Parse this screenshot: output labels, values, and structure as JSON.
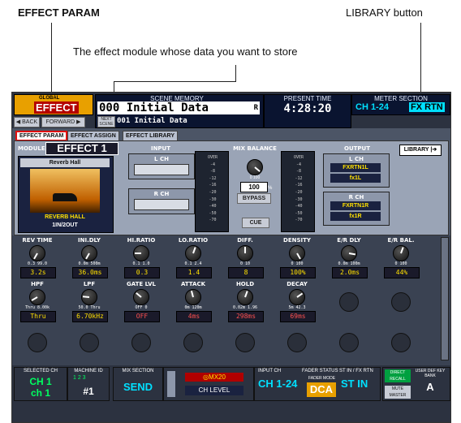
{
  "callouts": {
    "effect_param": "EFFECT PARAM",
    "library_button": "LIBRARY button",
    "module_note": "The effect module whose data you want to store"
  },
  "header": {
    "global_label": "GLOBAL",
    "effect_label": "EFFECT",
    "back": "◀ BACK",
    "forward": "FORWARD ▶",
    "scene_memory_title": "SCENE MEMORY",
    "scene_number": "000",
    "scene_name": "Initial Data",
    "scene_flag": "R",
    "next_scene_label": "NEXT SCENE",
    "next_scene": "001 Initial Data",
    "present_time_title": "PRESENT TIME",
    "present_time": "4:28:20",
    "meter_section_title": "METER SECTION",
    "meter_ch": "CH 1-24",
    "meter_fx": "FX RTN"
  },
  "tabs": [
    {
      "label": "EFFECT PARAM",
      "active": true
    },
    {
      "label": "EFFECT ASSIGN",
      "active": false
    },
    {
      "label": "EFFECT LIBRARY",
      "active": false
    }
  ],
  "module": {
    "label": "MODULE",
    "name": "EFFECT 1",
    "library_button": "LIBRARY",
    "effect_title": "Reverb Hall",
    "effect_type": "REVERB HALL",
    "io": "1IN/2OUT"
  },
  "input": {
    "title": "INPUT",
    "l_ch": "L CH",
    "r_ch": "R CH"
  },
  "meter_ticks": [
    "OVER",
    "-4",
    "-8",
    "-12",
    "-16",
    "-20",
    "-30",
    "-40",
    "-50",
    "-70"
  ],
  "mix": {
    "title": "MIX BALANCE",
    "range": "0  100",
    "value": "100",
    "unit": "%",
    "bypass": "BYPASS",
    "cue": "CUE"
  },
  "output": {
    "title": "OUTPUT",
    "l_ch": "L CH",
    "l_dest": "FXRTN1L",
    "l_port": "fx1L",
    "r_ch": "R CH",
    "r_dest": "FXRTN1R",
    "r_port": "fx1R"
  },
  "params_row1": [
    {
      "title": "REV TIME",
      "range": "0.3  99.0",
      "value": "3.2s"
    },
    {
      "title": "INI.DLY",
      "range": "0.0m  500m",
      "value": "36.0ms"
    },
    {
      "title": "HI.RATIO",
      "range": "0.1  1.0",
      "value": "0.3"
    },
    {
      "title": "LO.RATIO",
      "range": "0.1  2.4",
      "value": "1.4"
    },
    {
      "title": "DIFF.",
      "range": "0  10",
      "value": "8"
    },
    {
      "title": "DENSITY",
      "range": "0  100",
      "value": "100%"
    },
    {
      "title": "E/R DLY",
      "range": "0.0m  100m",
      "value": "2.0ms"
    },
    {
      "title": "E/R BAL.",
      "range": "0  100",
      "value": "44%"
    }
  ],
  "params_row2": [
    {
      "title": "HPF",
      "range": "Thru  8.00k",
      "value": "Thru",
      "red": false
    },
    {
      "title": "LPF",
      "range": "50.0  Thru",
      "value": "6.70kHz",
      "red": false
    },
    {
      "title": "GATE LVL",
      "range": "OFF  0",
      "value": "OFF",
      "red": true
    },
    {
      "title": "ATTACK",
      "range": "0m  120m",
      "value": "4ms",
      "red": true
    },
    {
      "title": "HOLD",
      "range": "0.02m  1.96",
      "value": "298ms",
      "red": true
    },
    {
      "title": "DECAY",
      "range": "5m  42.3",
      "value": "69ms",
      "red": true
    }
  ],
  "footer": {
    "selected_ch_label": "SELECTED CH",
    "ch": "CH 1",
    "ch_name": "ch 1",
    "machine_id_label": "MACHINE ID",
    "machine_nums": "1 2 3",
    "machine": "#1",
    "mix_section_label": "MIX SECTION",
    "send": "SEND",
    "model": "◎MX20",
    "ch_level": "CH LEVEL",
    "input_ch_label": "INPUT CH",
    "input_ch": "CH 1-24",
    "fader_status_label": "FADER STATUS",
    "fader_mode_label": "FADER MODE",
    "fader_mode": "DCA",
    "st_in_label": "ST IN / FX RTN",
    "st_in": "ST IN",
    "direct_recall": "DIRECT RECALL",
    "mute_master": "MUTE MASTER",
    "user_def_label": "USER DEF KEY BANK",
    "bank": "A"
  }
}
